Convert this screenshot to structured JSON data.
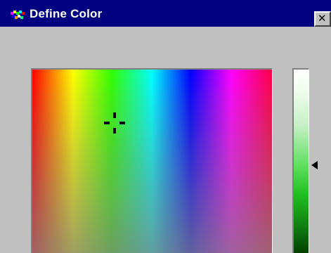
{
  "window": {
    "title": "Define Color",
    "close_glyph": "✕"
  },
  "icons": {
    "app": "define-color-app-icon",
    "close": "close-icon"
  },
  "color_picker": {
    "hue_spectrum": [
      "#ff0000",
      "#ff8800",
      "#ffff00",
      "#33ff00",
      "#00ffff",
      "#0000ff",
      "#ff00ff",
      "#ff0044"
    ],
    "luminance_range": [
      "#ffffff",
      "#60e060",
      "#004000"
    ],
    "luminance_level_percent": 52
  },
  "colors": {
    "titlebar": "#000080",
    "window_face": "#c0c0c0",
    "title_text": "#ffffff"
  }
}
